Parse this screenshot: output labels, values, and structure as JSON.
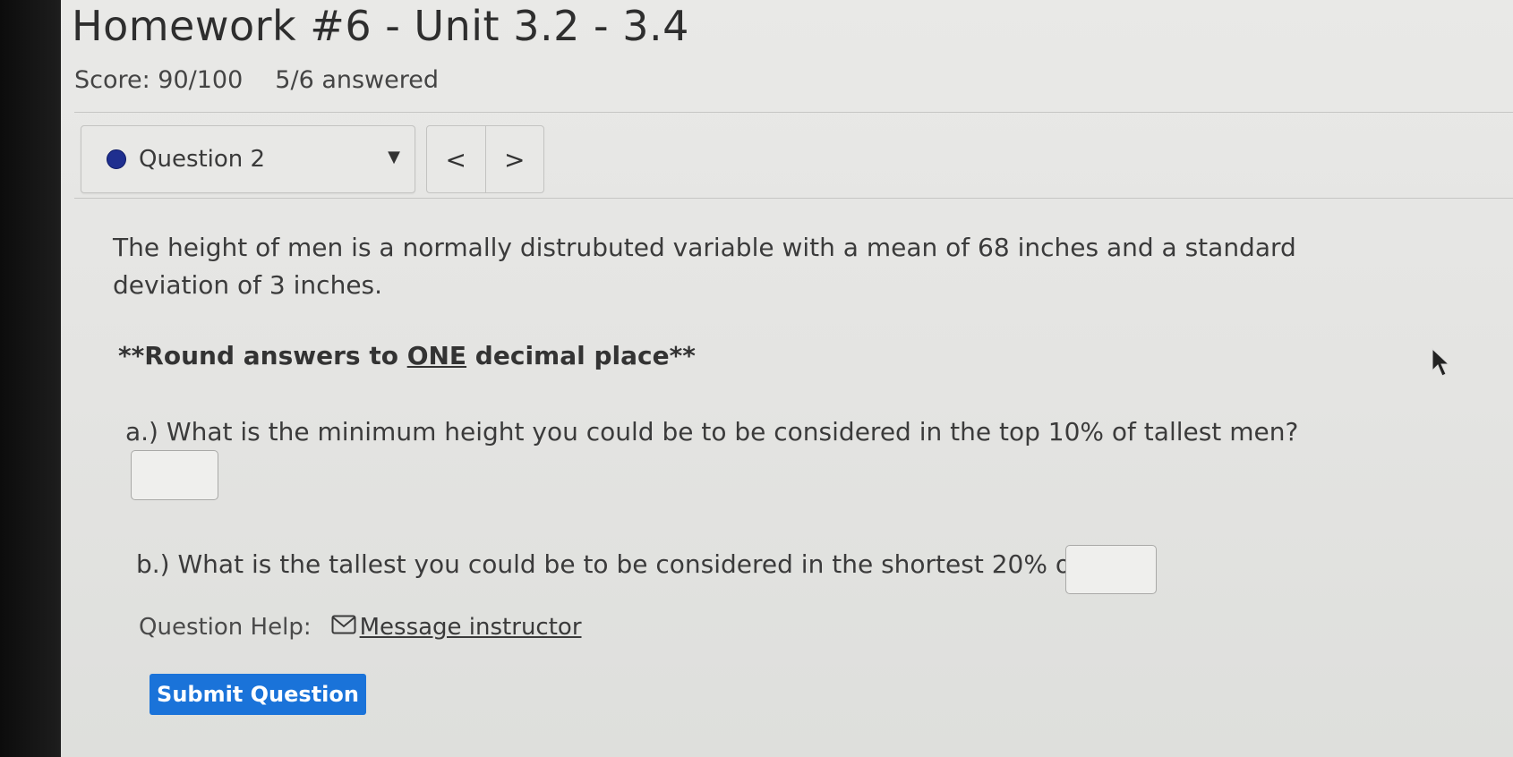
{
  "header": {
    "title": "Homework #6 - Unit 3.2 - 3.4",
    "score": "Score: 90/100",
    "answered": "5/6 answered"
  },
  "question_nav": {
    "current": "Question 2",
    "prev_symbol": "<",
    "next_symbol": ">"
  },
  "question": {
    "prompt": "The height of men is a normally distrubuted variable with a mean of 68 inches and a standard deviation of 3 inches.",
    "instruction_before": "**Round answers to ",
    "instruction_emph": "ONE",
    "instruction_after": " decimal place**",
    "part_a": "a.) What is the minimum height you could be to be considered in the top 10% of tallest men?",
    "part_a_value": "",
    "part_b": "b.) What is the tallest you could be to be considered in the shortest 20% of men?",
    "part_b_value": ""
  },
  "help": {
    "label": "Question Help:",
    "link": "Message instructor"
  },
  "actions": {
    "submit_label": "Submit Question"
  },
  "colors": {
    "status_dot": "#1f2f8f",
    "submit_bg": "#1a73d9"
  }
}
